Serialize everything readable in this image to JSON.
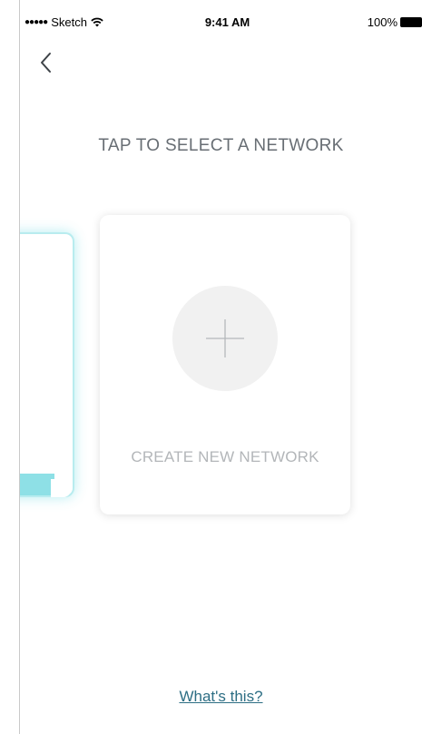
{
  "status_bar": {
    "signal": "●●●●●",
    "carrier": "Sketch",
    "time": "9:41 AM",
    "battery": "100%"
  },
  "header": {
    "back_icon": "chevron-left-icon"
  },
  "page": {
    "title": "TAP TO SELECT A NETWORK"
  },
  "cards": {
    "create": {
      "icon": "plus-icon",
      "label": "CREATE NEW NETWORK"
    }
  },
  "footer": {
    "help_link": "What's this?"
  },
  "colors": {
    "accent": "#8ee0e6",
    "accent_glow": "#5ad7e1",
    "link": "#2d6e84",
    "title": "#686e74",
    "muted": "#b3b6b9"
  }
}
